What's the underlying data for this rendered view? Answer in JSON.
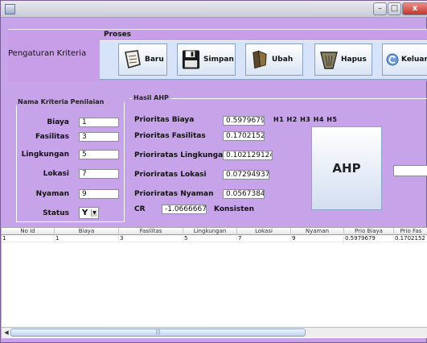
{
  "window": {
    "title": "",
    "controls": {
      "minimize": "–",
      "maximize": "□",
      "close": "x"
    }
  },
  "header": {
    "title": "Pengaturan Kriteria",
    "section_label": "Proses"
  },
  "toolbar": {
    "buttons": [
      {
        "label": "Baru",
        "icon": "document-new-icon"
      },
      {
        "label": "Simpan",
        "icon": "floppy-save-icon"
      },
      {
        "label": "Ubah",
        "icon": "edit-icon"
      },
      {
        "label": "Hapus",
        "icon": "trash-icon"
      },
      {
        "label": "Keluar",
        "icon": "exit-arrow-icon"
      }
    ]
  },
  "left_panel": {
    "title": "Nama Kriteria Penilaian",
    "fields": [
      {
        "label": "Biaya",
        "value": "1"
      },
      {
        "label": "Fasilitas",
        "value": "3"
      },
      {
        "label": "Lingkungan",
        "value": "5"
      },
      {
        "label": "Lokasi",
        "value": "7"
      },
      {
        "label": "Nyaman",
        "value": "9"
      }
    ],
    "status_label": "Status",
    "status_value": "Y"
  },
  "right_panel": {
    "title": "Hasil AHP",
    "fields": [
      {
        "label": "Prioritas Biaya",
        "value": "0.5979679"
      },
      {
        "label": "Prioritas Fasilitas",
        "value": "0.1702152"
      },
      {
        "label": "Prioriratas Lingkungan",
        "value": "0.102129124"
      },
      {
        "label": "Prioriratas Lokasi",
        "value": "0.07294937"
      },
      {
        "label": "Prioriratas Nyaman",
        "value": "0.0567384"
      }
    ],
    "cr_label": "CR",
    "cr_value": "-1.0666667",
    "cr_status": "Konsisten",
    "h_labels": "H1 H2 H3 H4  H5",
    "ahp_button": "AHP",
    "result_value": ""
  },
  "table": {
    "columns": [
      "No Id",
      "Biaya",
      "Fasilitas",
      "Lingkungan",
      "Lokasi",
      "Nyaman",
      "Prio Biaya",
      "Prio Fas"
    ],
    "rows": [
      [
        "1",
        "1",
        "3",
        "5",
        "7",
        "9",
        "0.5979679",
        "0.1702152"
      ]
    ]
  },
  "scrollbar": {
    "thumb_grip": "|||"
  },
  "colors": {
    "window_background": "#c7a3e9",
    "toolbar_background": "#d6e3f9",
    "close_button": "#c2352d"
  }
}
